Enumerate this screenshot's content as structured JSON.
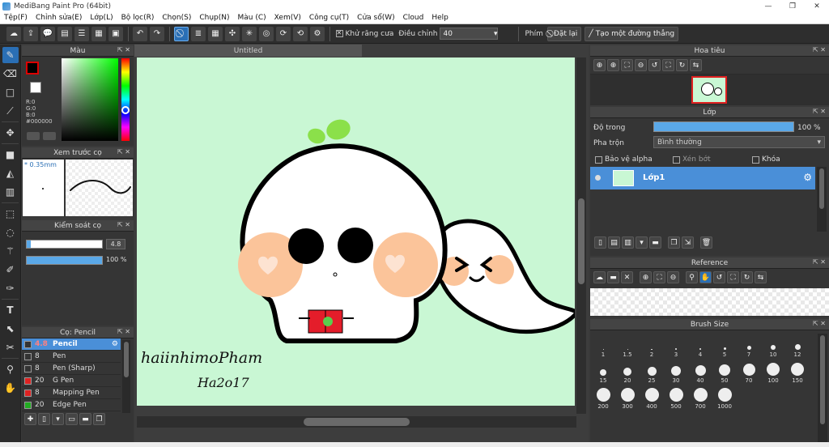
{
  "window": {
    "title": "MediBang Paint Pro (64bit)"
  },
  "menu": [
    "Tệp(F)",
    "Chỉnh sửa(E)",
    "Lớp(L)",
    "Bộ lọc(R)",
    "Chọn(S)",
    "Chụp(N)",
    "Màu (C)",
    "Xem(V)",
    "Công cụ(T)",
    "Cửa sổ(W)",
    "Cloud",
    "Help"
  ],
  "toolbar": {
    "antialias_label": "Khử răng cưa",
    "adjust_label": "Điều chỉnh",
    "adjust_value": "40",
    "ruler_label": "Phím",
    "reset_label": "Đặt lại",
    "create_line_label": "Tạo một đường thẳng"
  },
  "color_panel": {
    "title": "Màu",
    "r": "R:0",
    "g": "G:0",
    "b": "B:0",
    "hex": "#000000"
  },
  "preview_panel": {
    "title": "Xem trước cọ",
    "size": "0.35mm"
  },
  "brush_control": {
    "title": "Kiểm soát cọ",
    "size_value": "4.8",
    "opacity_value": "100 %",
    "size_fraction": 0.05,
    "opacity_fraction": 1.0
  },
  "brush_list": {
    "title": "Cọ: Pencil",
    "items": [
      {
        "size": "4.8",
        "name": "Pencil",
        "color": "#333333",
        "selected": true
      },
      {
        "size": "8",
        "name": "Pen",
        "color": "#333333"
      },
      {
        "size": "8",
        "name": "Pen (Sharp)",
        "color": "#333333"
      },
      {
        "size": "20",
        "name": "G Pen",
        "color": "#dd2222"
      },
      {
        "size": "8",
        "name": "Mapping Pen",
        "color": "#dd2222"
      },
      {
        "size": "20",
        "name": "Edge Pen",
        "color": "#22aa22"
      }
    ]
  },
  "document": {
    "tab": "Untitled"
  },
  "navigator": {
    "title": "Hoa tiêu"
  },
  "layer_panel": {
    "title": "Lớp",
    "opacity_label": "Độ trong",
    "opacity_value": "100 %",
    "opacity_fraction": 1.0,
    "blend_label": "Pha trộn",
    "blend_value": "Bình thường",
    "protect_alpha": "Bảo vệ alpha",
    "clipping": "Xén bớt",
    "lock": "Khóa",
    "layer_name": "Lớp1"
  },
  "reference_panel": {
    "title": "Reference"
  },
  "brush_size_panel": {
    "title": "Brush Size",
    "sizes": [
      "1",
      "1.5",
      "2",
      "3",
      "4",
      "5",
      "7",
      "10",
      "12",
      "15",
      "20",
      "25",
      "30",
      "40",
      "50",
      "70",
      "100",
      "150",
      "200",
      "300",
      "400",
      "500",
      "700",
      "1000"
    ]
  },
  "artwork": {
    "signature_line1": "haiinhimoPham",
    "signature_line2": "Ha2o17"
  },
  "colors": {
    "accent": "#2a6fb5",
    "canvas_bg": "#c9f7d4",
    "selection": "#4a8fd8"
  }
}
